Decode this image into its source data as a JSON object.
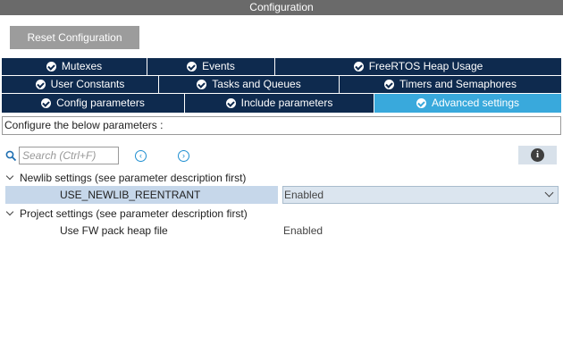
{
  "window": {
    "title": "Configuration"
  },
  "toolbar": {
    "reset_label": "Reset Configuration"
  },
  "tabs": {
    "row1": [
      {
        "label": "Mutexes"
      },
      {
        "label": "Events"
      },
      {
        "label": "FreeRTOS Heap Usage"
      }
    ],
    "row2": [
      {
        "label": "User Constants"
      },
      {
        "label": "Tasks and Queues"
      },
      {
        "label": "Timers and Semaphores"
      }
    ],
    "row3": [
      {
        "label": "Config parameters"
      },
      {
        "label": "Include parameters"
      },
      {
        "label": "Advanced settings",
        "active": true
      }
    ]
  },
  "panel": {
    "header": "Configure the below parameters :"
  },
  "search": {
    "placeholder": "Search (Ctrl+F)",
    "value": ""
  },
  "groups": [
    {
      "label": "Newlib settings (see parameter description first)",
      "params": [
        {
          "name": "USE_NEWLIB_REENTRANT",
          "value": "Enabled",
          "selected": true
        }
      ]
    },
    {
      "label": "Project settings (see parameter description first)",
      "params": [
        {
          "name": "Use FW pack heap file",
          "value": "Enabled",
          "selected": false
        }
      ]
    }
  ],
  "colors": {
    "tab_bg": "#0e2a4e",
    "tab_active": "#39a9dc",
    "title_bar": "#6a6a6a",
    "reset_button": "#9c9c9c",
    "selected_row": "#c6d7ea",
    "nav_icon": "#1f8fd1"
  },
  "icons": {
    "search": "magnifier-icon",
    "prev": "chevron-left-circle-icon",
    "next": "chevron-right-circle-icon",
    "info": "info-icon",
    "tab_status": "check-circle-icon",
    "group_toggle": "chevron-down-icon",
    "dropdown": "chevron-down-icon"
  }
}
